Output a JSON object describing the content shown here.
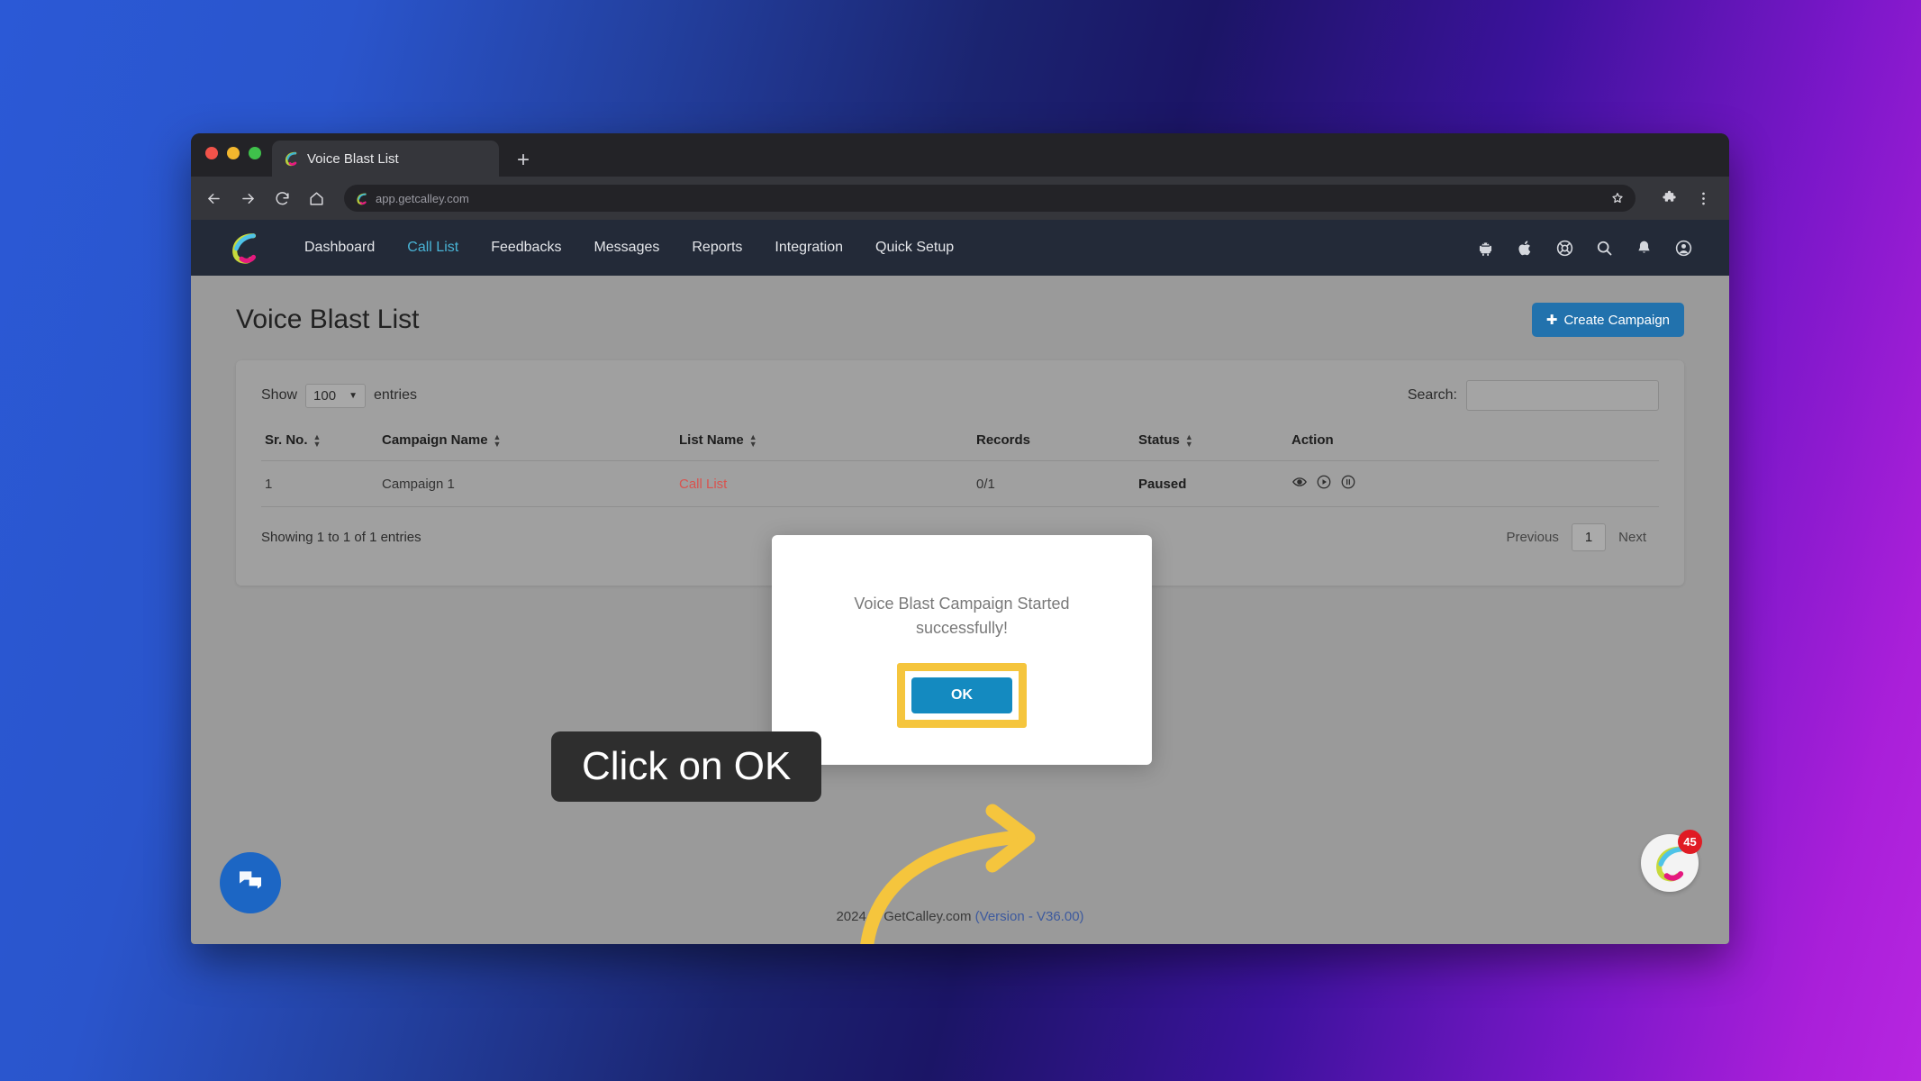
{
  "browser": {
    "tab_title": "Voice Blast List",
    "new_tab_label": "+",
    "url": "app.getcalley.com",
    "icons": {
      "back": "back-arrow-icon",
      "forward": "forward-arrow-icon",
      "reload": "reload-icon",
      "home": "home-icon",
      "bookmark": "star-icon",
      "extensions": "puzzle-piece-icon",
      "menu": "three-dot-menu-icon"
    }
  },
  "appnav": {
    "brand": "calley-logo",
    "links": [
      {
        "label": "Dashboard",
        "active": false
      },
      {
        "label": "Call List",
        "active": true
      },
      {
        "label": "Feedbacks",
        "active": false
      },
      {
        "label": "Messages",
        "active": false
      },
      {
        "label": "Reports",
        "active": false
      },
      {
        "label": "Integration",
        "active": false
      },
      {
        "label": "Quick Setup",
        "active": false
      }
    ],
    "tools": [
      "android-icon",
      "apple-icon",
      "lifebuoy-support-icon",
      "search-icon",
      "bell-icon",
      "user-account-icon"
    ]
  },
  "page": {
    "title": "Voice Blast List",
    "create_button": "Create Campaign",
    "create_button_icon": "plus-icon"
  },
  "table_controls": {
    "show_label": "Show",
    "entries_value": "100",
    "entries_label": "entries",
    "search_label": "Search:",
    "search_value": "",
    "search_placeholder": ""
  },
  "table": {
    "columns": [
      {
        "label": "Sr. No.",
        "sortable": true
      },
      {
        "label": "Campaign Name",
        "sortable": true
      },
      {
        "label": "List Name",
        "sortable": true
      },
      {
        "label": "Records",
        "sortable": false
      },
      {
        "label": "Status",
        "sortable": true
      },
      {
        "label": "Action",
        "sortable": false
      }
    ],
    "rows": [
      {
        "sr_no": "1",
        "campaign_name": "Campaign 1",
        "list_name": "Call List",
        "records": "0/1",
        "status": "Paused",
        "actions": [
          "eye-icon",
          "play-circle-icon",
          "pause-circle-icon"
        ]
      }
    ]
  },
  "pagination": {
    "showing": "Showing 1 to 1 of 1 entries",
    "previous": "Previous",
    "current_page": "1",
    "next": "Next"
  },
  "footer": {
    "copyright": "2024 © GetCalley.com ",
    "version": "(Version - V36.00)"
  },
  "widgets": {
    "chat_icon": "chat-bubbles-icon",
    "calley_badge_count": "45"
  },
  "modal": {
    "message": "Voice Blast Campaign Started successfully!",
    "ok_label": "OK",
    "highlight_color": "#f5c53d",
    "ok_color": "#148ac0"
  },
  "annotation": {
    "callout_text": "Click on OK",
    "arrow_color": "#f5c53d",
    "callout_bg": "#2e2e2e"
  }
}
